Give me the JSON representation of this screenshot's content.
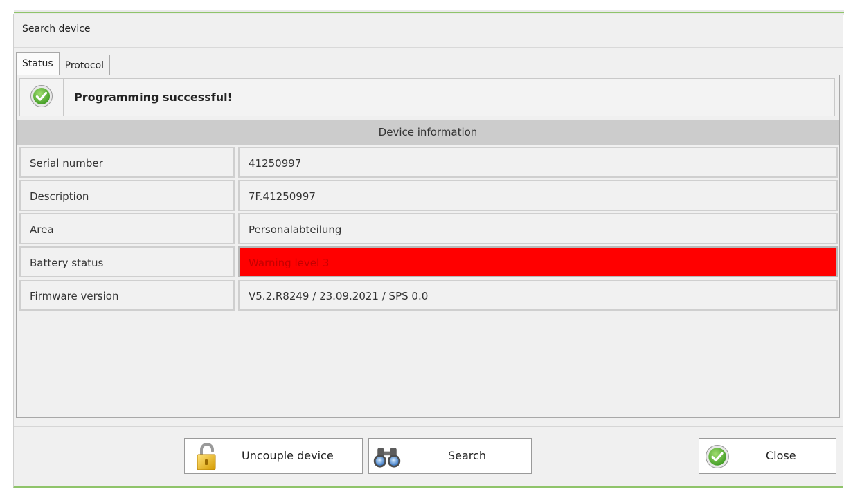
{
  "dialog": {
    "title": "Search device"
  },
  "tabs": [
    {
      "label": "Status",
      "active": true
    },
    {
      "label": "Protocol",
      "active": false
    }
  ],
  "status": {
    "icon": "check-circle-icon",
    "message": "Programming successful!"
  },
  "device_info": {
    "header": "Device information",
    "rows": [
      {
        "label": "Serial number",
        "value": "41250997"
      },
      {
        "label": "Description",
        "value": "7F.41250997"
      },
      {
        "label": "Area",
        "value": "Personalabteilung"
      },
      {
        "label": "Battery status",
        "value": "Warning level 3",
        "warning": true
      },
      {
        "label": "Firmware version",
        "value": "V5.2.R8249 / 23.09.2021 / SPS 0.0"
      }
    ]
  },
  "buttons": {
    "uncouple": {
      "label": "Uncouple device",
      "icon": "open-padlock-icon"
    },
    "search": {
      "label": "Search",
      "icon": "binoculars-icon"
    },
    "close": {
      "label": "Close",
      "icon": "check-circle-icon"
    }
  },
  "colors": {
    "warning_bg": "#ff0000",
    "accent_green": "#8fc46a",
    "success_green": "#5fb336"
  }
}
